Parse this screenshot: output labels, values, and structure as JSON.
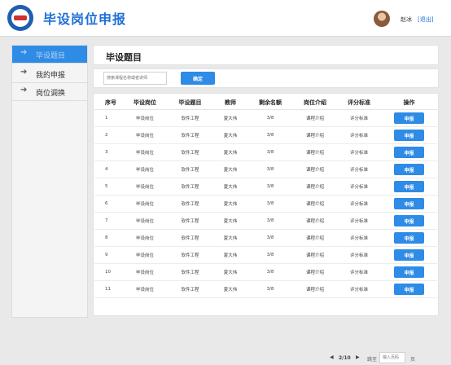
{
  "header": {
    "title": "毕设岗位申报",
    "user_name": "赵冰",
    "logout_label": "[退出]"
  },
  "sidebar": {
    "items": [
      {
        "label": "毕设题目",
        "active": true
      },
      {
        "label": "我的申报",
        "active": false
      },
      {
        "label": "岗位调换",
        "active": false
      }
    ]
  },
  "main": {
    "panel_title": "毕设题目",
    "search": {
      "placeholder": "搜索课程名称或者讲师",
      "button_label": "确定"
    },
    "table": {
      "columns": [
        "序号",
        "毕设岗位",
        "毕设题目",
        "教师",
        "剩余名额",
        "岗位介绍",
        "评分标准",
        "操作"
      ],
      "rows": [
        {
          "no": "1",
          "post": "毕设岗位",
          "topic": "软件工程",
          "teacher": "夏大伟",
          "quota": "3/8",
          "intro": "课程介绍",
          "criteria": "评分标准",
          "action": "申报"
        },
        {
          "no": "2",
          "post": "毕设岗位",
          "topic": "软件工程",
          "teacher": "夏大伟",
          "quota": "3/8",
          "intro": "课程介绍",
          "criteria": "评分标准",
          "action": "申报"
        },
        {
          "no": "3",
          "post": "毕设岗位",
          "topic": "软件工程",
          "teacher": "夏大伟",
          "quota": "3/8",
          "intro": "课程介绍",
          "criteria": "评分标准",
          "action": "申报"
        },
        {
          "no": "4",
          "post": "毕设岗位",
          "topic": "软件工程",
          "teacher": "夏大伟",
          "quota": "3/8",
          "intro": "课程介绍",
          "criteria": "评分标准",
          "action": "申报"
        },
        {
          "no": "5",
          "post": "毕设岗位",
          "topic": "软件工程",
          "teacher": "夏大伟",
          "quota": "3/8",
          "intro": "课程介绍",
          "criteria": "评分标准",
          "action": "申报"
        },
        {
          "no": "6",
          "post": "毕设岗位",
          "topic": "软件工程",
          "teacher": "夏大伟",
          "quota": "3/8",
          "intro": "课程介绍",
          "criteria": "评分标准",
          "action": "申报"
        },
        {
          "no": "7",
          "post": "毕设岗位",
          "topic": "软件工程",
          "teacher": "夏大伟",
          "quota": "3/8",
          "intro": "课程介绍",
          "criteria": "评分标准",
          "action": "申报"
        },
        {
          "no": "8",
          "post": "毕设岗位",
          "topic": "软件工程",
          "teacher": "夏大伟",
          "quota": "3/8",
          "intro": "课程介绍",
          "criteria": "评分标准",
          "action": "申报"
        },
        {
          "no": "9",
          "post": "毕设岗位",
          "topic": "软件工程",
          "teacher": "夏大伟",
          "quota": "3/8",
          "intro": "课程介绍",
          "criteria": "评分标准",
          "action": "申报"
        },
        {
          "no": "10",
          "post": "毕设岗位",
          "topic": "软件工程",
          "teacher": "夏大伟",
          "quota": "3/8",
          "intro": "课程介绍",
          "criteria": "评分标准",
          "action": "申报"
        },
        {
          "no": "11",
          "post": "毕设岗位",
          "topic": "软件工程",
          "teacher": "夏大伟",
          "quota": "3/8",
          "intro": "课程介绍",
          "criteria": "评分标准",
          "action": "申报"
        }
      ]
    },
    "pagination": {
      "page_info": "2/10",
      "jump_label": "跳至",
      "input_placeholder": "输入页码",
      "unit_label": "页"
    }
  },
  "colors": {
    "accent": "#2e8be6",
    "title_blue": "#1e6fd9"
  }
}
